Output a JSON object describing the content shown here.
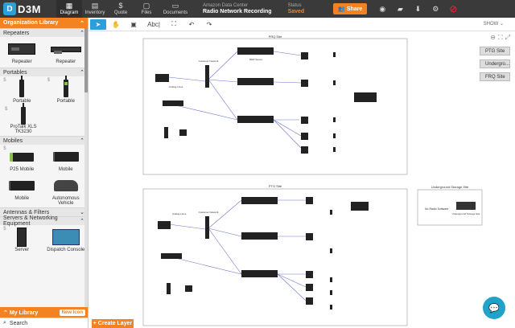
{
  "app": {
    "logo": "D3M"
  },
  "nav": {
    "tabs": [
      {
        "label": "Diagram",
        "icon": "diagram-icon"
      },
      {
        "label": "Inventory",
        "icon": "inventory-icon"
      },
      {
        "label": "Quote",
        "icon": "quote-icon"
      },
      {
        "label": "Files",
        "icon": "files-icon"
      },
      {
        "label": "Documents",
        "icon": "documents-icon"
      }
    ]
  },
  "project": {
    "org": "Amazon Data Center",
    "name": "Radio Network Recording"
  },
  "status": {
    "label": "Status",
    "value": "Saved"
  },
  "share_label": "Share",
  "library": {
    "title": "Organization Library",
    "sections": {
      "repeaters": {
        "title": "Repeaters",
        "items": [
          "Repeater",
          "Repeater"
        ]
      },
      "portables": {
        "title": "Portables",
        "items": [
          "Portable",
          "Portable",
          "ProTalk XLS TK3230"
        ]
      },
      "mobiles": {
        "title": "Mobiles",
        "items": [
          "P25 Mobile",
          "Mobile",
          "Mobile",
          "Autonomous Vehicle"
        ]
      },
      "antennas": {
        "title": "Antennas & Filters"
      },
      "servers": {
        "title": "Servers & Networking Equipment",
        "items": [
          "Server",
          "Dispatch Console"
        ]
      }
    },
    "my_library": "My Library",
    "new_icon": "New Icon",
    "search_placeholder": "Search"
  },
  "toolbar": {
    "text_tool": "Abc",
    "show_label": "SHOW"
  },
  "layers": [
    "PTG Site",
    "Undergro...",
    "FRQ Site"
  ],
  "create_layer": "+ Create Layer",
  "diagram": {
    "site1_title": "PRQ Site",
    "site2_title": "PTG Site",
    "site3_title": "Underground Storage Site",
    "rda_label": "RDR Server",
    "analog_label": "Analog Lines",
    "customer_network": "Customer Network",
    "no_radio": "No Radio Software",
    "underground_device": "Underground Storage Site",
    "colors": {
      "wire": "#6a73c9",
      "black": "#222222",
      "accent": "#f58220"
    }
  }
}
